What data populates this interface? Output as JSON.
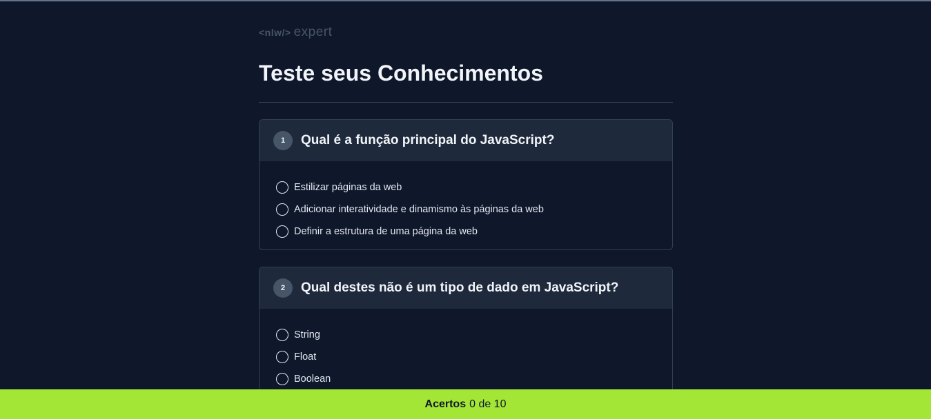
{
  "logo": {
    "tag": "<nlw/>",
    "word": "expert"
  },
  "header": {
    "title": "Teste seus Conhecimentos"
  },
  "questions": [
    {
      "number": "1",
      "text": "Qual é a função principal do JavaScript?",
      "options": [
        "Estilizar páginas da web",
        "Adicionar interatividade e dinamismo às páginas da web",
        "Definir a estrutura de uma página da web"
      ]
    },
    {
      "number": "2",
      "text": "Qual destes não é um tipo de dado em JavaScript?",
      "options": [
        "String",
        "Float",
        "Boolean"
      ]
    }
  ],
  "footer": {
    "label": "Acertos",
    "score": "0 de 10"
  },
  "colors": {
    "background": "#0f172a",
    "card_header": "#1e293b",
    "accent": "#a3e635"
  }
}
